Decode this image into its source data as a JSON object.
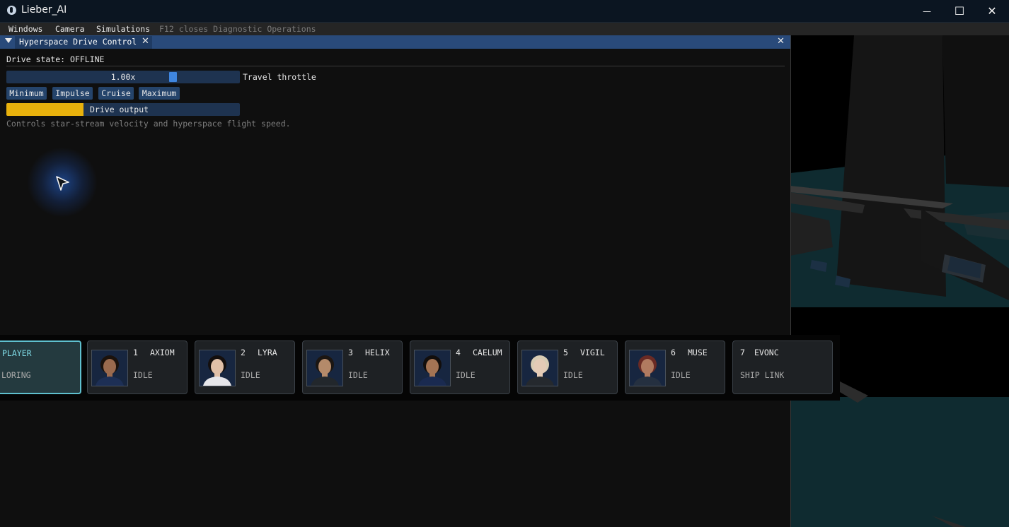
{
  "app": {
    "title": "Lieber_AI"
  },
  "window_controls": {
    "minimize": "—",
    "maximize": "☐",
    "close": "✕"
  },
  "menubar": {
    "items": [
      "Windows",
      "Camera",
      "Simulations"
    ],
    "hint": "F12 closes Diagnostic Operations"
  },
  "panel": {
    "title": "Hyperspace Drive Control",
    "close_glyph": "✕",
    "drive_state": "Drive state: OFFLINE",
    "throttle": {
      "value_text": "1.00x",
      "label": "Travel throttle",
      "level": 0.72
    },
    "presets": [
      "Minimum",
      "Impulse",
      "Cruise",
      "Maximum"
    ],
    "output": {
      "label": "Drive output",
      "level": 0.33
    },
    "description": "Controls star-stream velocity and hyperspace flight speed."
  },
  "crew": [
    {
      "num": "",
      "name": "PLAYER",
      "status": "LORING",
      "active": true,
      "portrait": false
    },
    {
      "num": "1",
      "name": "AXIOM",
      "status": "IDLE",
      "active": false,
      "portrait": true,
      "skin": "#9a6a4e",
      "hair": "#1b120c",
      "uniform": "#1d2f55"
    },
    {
      "num": "2",
      "name": "LYRA",
      "status": "IDLE",
      "active": false,
      "portrait": true,
      "skin": "#e0c0a8",
      "hair": "#140f0e",
      "uniform": "#e6e6ea"
    },
    {
      "num": "3",
      "name": "HELIX",
      "status": "IDLE",
      "active": false,
      "portrait": true,
      "skin": "#b48a6a",
      "hair": "#1c1612",
      "uniform": "#22272c"
    },
    {
      "num": "4",
      "name": "CAELUM",
      "status": "IDLE",
      "active": false,
      "portrait": true,
      "skin": "#a47454",
      "hair": "#120e0c",
      "uniform": "#1a2a50"
    },
    {
      "num": "5",
      "name": "VIGIL",
      "status": "IDLE",
      "active": false,
      "portrait": true,
      "skin": "#e4cbb6",
      "hair": "#d8ccb4",
      "uniform": "#25292e"
    },
    {
      "num": "6",
      "name": "MUSE",
      "status": "IDLE",
      "active": false,
      "portrait": true,
      "skin": "#b07a60",
      "hair": "#6a2a24",
      "uniform": "#253040"
    },
    {
      "num": "7",
      "name": "EVONC",
      "status": "SHIP LINK",
      "active": false,
      "portrait": false
    }
  ]
}
